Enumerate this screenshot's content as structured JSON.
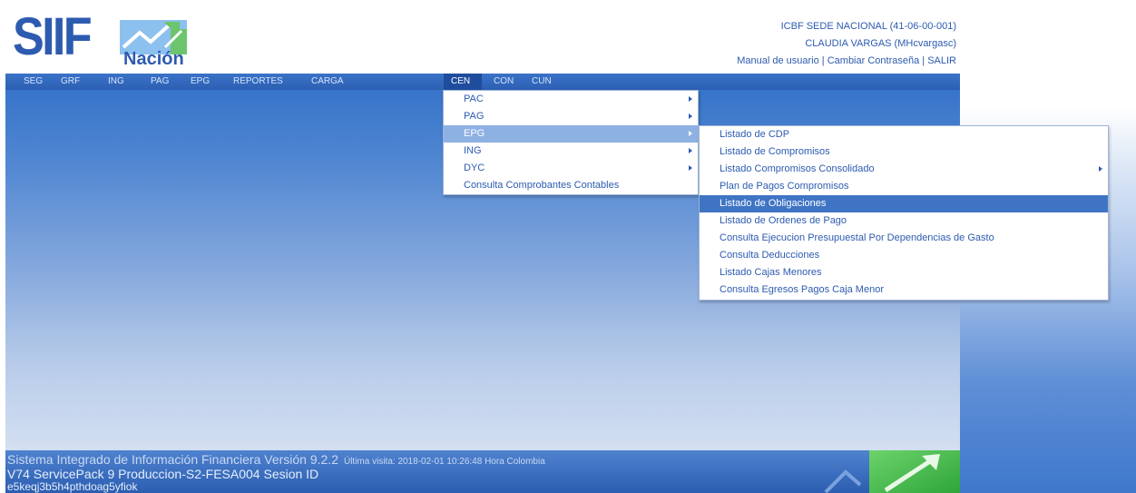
{
  "header": {
    "logo_text": "SIIF",
    "logo_subtext": "Nación",
    "entity": "ICBF SEDE NACIONAL (41-06-00-001)",
    "user": "CLAUDIA VARGAS (MHcvargasc)",
    "links": {
      "manual": "Manual de usuario",
      "change_password": "Cambiar Contraseña",
      "logout": "SALIR",
      "separator": "|"
    }
  },
  "menubar": {
    "items": [
      "SEG",
      "GRF",
      "ING",
      "PAG",
      "EPG",
      "REPORTES",
      "CARGA",
      "CEN",
      "CON",
      "CUN"
    ],
    "active": "CEN"
  },
  "submenu_cen": {
    "items": [
      "PAC",
      "PAG",
      "EPG",
      "ING",
      "DYC",
      "Consulta Comprobantes Contables"
    ],
    "selected": "EPG"
  },
  "submenu_epg": {
    "items": [
      "Listado de CDP",
      "Listado de Compromisos",
      "Listado Compromisos Consolidado",
      "Plan de Pagos Compromisos",
      "Listado de Obligaciones",
      "Listado de Ordenes de Pago",
      "Consulta Ejecucion Presupuestal Por Dependencias de Gasto",
      "Consulta Deducciones",
      "Listado Cajas Menores",
      "Consulta Egresos Pagos Caja Menor"
    ],
    "selected": "Listado de Obligaciones"
  },
  "footer": {
    "system_name": "Sistema Integrado de Información Financiera Versión 9.2.2",
    "last_visit": "Última visita: 2018-02-01 10:26:48 Hora Colombia",
    "version": "V74 ServicePack 9 Produccion-S2-FESA004 Sesion ID",
    "session_id": "e5keqj3b5h4pthdoag5yfiok"
  },
  "colors": {
    "brand_blue": "#2d5bb0",
    "menu_selected": "#8db1e3",
    "submenu_selected": "#3f74c5",
    "footer_green": "#3fb34a"
  },
  "icons": [
    "siif-logo-emblem-icon",
    "submenu-arrow-icon",
    "footer-arrow-decoration-icon"
  ]
}
